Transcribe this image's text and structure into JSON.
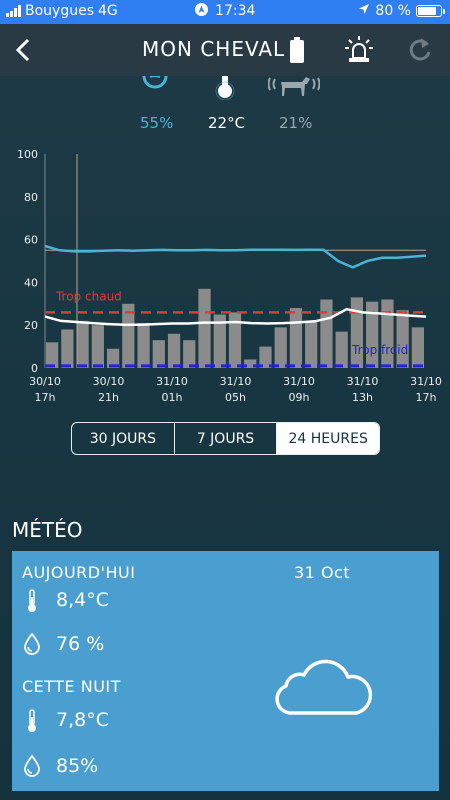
{
  "status_bar": {
    "carrier": "Bouygues",
    "network": "4G",
    "time": "17:34",
    "battery_percent": "80 %",
    "battery_level": 0.8
  },
  "nav": {
    "title": "MON CHEVAL"
  },
  "sensors": [
    {
      "icon": "humidity-icon",
      "value": "55%",
      "color": "#4ab3d6"
    },
    {
      "icon": "temperature-icon",
      "value": "22°C",
      "color": "#ffffff"
    },
    {
      "icon": "horse-activity-icon",
      "value": "21%",
      "color": "#9aa7ad"
    }
  ],
  "chart_data": {
    "type": "bar",
    "y_ticks": [
      "100",
      "80",
      "60",
      "40",
      "20",
      "0"
    ],
    "ylim": [
      0,
      100
    ],
    "x_ticks": [
      {
        "date": "30/10",
        "hour": "17h"
      },
      {
        "date": "30/10",
        "hour": "21h"
      },
      {
        "date": "31/10",
        "hour": "01h"
      },
      {
        "date": "31/10",
        "hour": "05h"
      },
      {
        "date": "31/10",
        "hour": "09h"
      },
      {
        "date": "31/10",
        "hour": "13h"
      },
      {
        "date": "31/10",
        "hour": "17h"
      }
    ],
    "bars": [
      12,
      18,
      22,
      20,
      9,
      30,
      21,
      13,
      16,
      13,
      37,
      25,
      26,
      4,
      10,
      19,
      28,
      22,
      32,
      17,
      33,
      31,
      32,
      27,
      19
    ],
    "humidity_line": [
      57,
      55,
      54.5,
      54.5,
      54.8,
      55,
      54.8,
      55,
      55.2,
      55,
      55,
      55.2,
      55,
      55,
      55.3,
      55.3,
      55.3,
      55.2,
      55.3,
      55.3,
      50,
      47,
      50,
      51.5,
      51.5,
      52,
      52.5
    ],
    "temperature_line": [
      24,
      22,
      21.5,
      21,
      20.5,
      20.2,
      20.2,
      20.5,
      20.8,
      20.8,
      21.2,
      21.2,
      21.5,
      21,
      20.8,
      21,
      21.3,
      21.8,
      23.5,
      27.5,
      26,
      25.5,
      25,
      24.5,
      24
    ],
    "hot_threshold": {
      "value": 26,
      "label": "Trop chaud",
      "color": "#e03a3a"
    },
    "cold_threshold": {
      "value": 1,
      "label": "Trop froid",
      "color": "#2323d6"
    },
    "reference_line": 55,
    "colors": {
      "bars": "#8b8b8b",
      "humidity": "#4ab3d6",
      "temperature": "#ffffff"
    }
  },
  "range_selector": {
    "options": [
      "30 JOURS",
      "7 JOURS",
      "24 HEURES"
    ],
    "selected": "24 HEURES"
  },
  "weather": {
    "section_title": "MÉTÉO",
    "today_label": "AUJOURD'HUI",
    "date": "31 Oct",
    "today_temp": "8,4°C",
    "today_humidity": "76 %",
    "night_label": "CETTE NUIT",
    "night_temp": "7,8°C",
    "night_humidity": "85%",
    "condition_icon": "cloud-icon",
    "card_color": "#4a9fd0"
  }
}
